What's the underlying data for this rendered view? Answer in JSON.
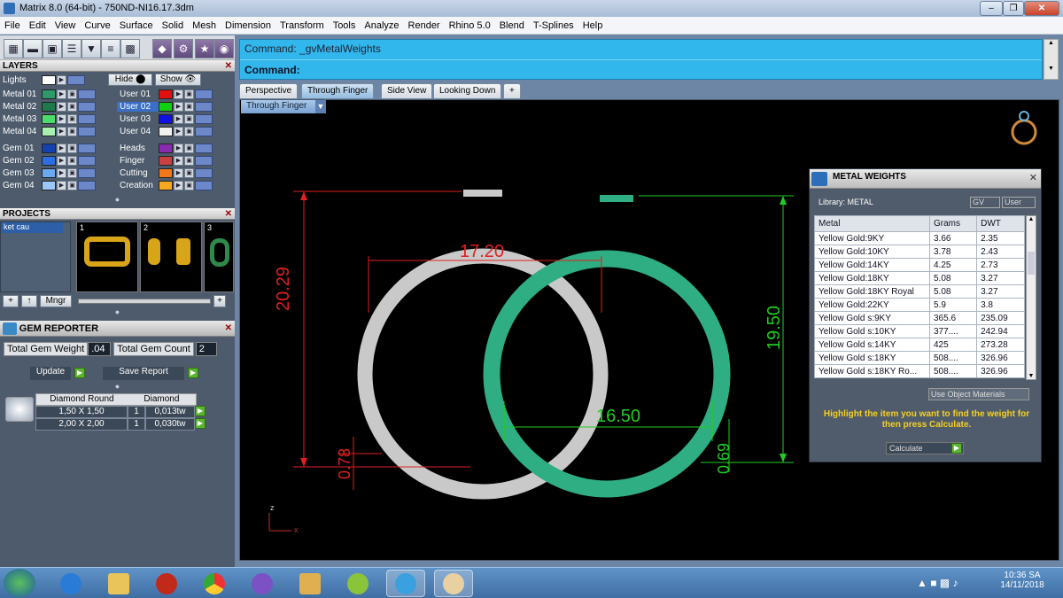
{
  "window": {
    "title": "Matrix 8.0 (64-bit) - 750ND-NI16.17.3dm"
  },
  "menu": [
    "File",
    "Edit",
    "View",
    "Curve",
    "Surface",
    "Solid",
    "Mesh",
    "Dimension",
    "Transform",
    "Tools",
    "Analyze",
    "Render",
    "Rhino 5.0",
    "Blend",
    "T-Splines",
    "Help"
  ],
  "layers": {
    "title": "LAYERS",
    "lights": "Lights",
    "hide": "Hide",
    "show": "Show",
    "left_rows": [
      {
        "name": "Metal 01",
        "color": "#2e9a6a"
      },
      {
        "name": "Metal 02",
        "color": "#1e7a4a"
      },
      {
        "name": "Metal 03",
        "color": "#4cdc6c"
      },
      {
        "name": "Metal 04",
        "color": "#a8f0b0"
      },
      {
        "name": "Gem 01",
        "color": "#1440b0"
      },
      {
        "name": "Gem 02",
        "color": "#2d6ee0"
      },
      {
        "name": "Gem 03",
        "color": "#6aa8f0"
      },
      {
        "name": "Gem 04",
        "color": "#9cc8f8"
      }
    ],
    "right_rows": [
      {
        "name": "User 01",
        "color": "#e01010"
      },
      {
        "name": "User 02",
        "color": "#10d010"
      },
      {
        "name": "User 03",
        "color": "#1010e0"
      },
      {
        "name": "User 04",
        "color": "#f0f0f0"
      },
      {
        "name": "Heads",
        "color": "#8a2ab0"
      },
      {
        "name": "Finger",
        "color": "#c84040"
      },
      {
        "name": "Cutting",
        "color": "#f07818"
      },
      {
        "name": "Creation",
        "color": "#f8a820"
      }
    ]
  },
  "projects": {
    "title": "PROJECTS",
    "item": "ket cau",
    "thumbs": [
      "1",
      "2",
      "3"
    ],
    "mngr": "Mngr"
  },
  "gem_reporter": {
    "title": "GEM REPORTER",
    "total_weight_label": "Total Gem Weight",
    "total_weight": ".04",
    "total_count_label": "Total Gem Count",
    "total_count": "2",
    "update": "Update",
    "save_report": "Save Report",
    "col1": "Diamond Round",
    "col2": "Diamond",
    "rows": [
      {
        "size": "1,50 X 1,50",
        "qty": "1",
        "weight": "0,013tw"
      },
      {
        "size": "2,00 X 2,00",
        "qty": "1",
        "weight": "0,030tw"
      }
    ]
  },
  "command": {
    "line1": "Command: _gvMetalWeights",
    "line2": "Command:"
  },
  "view_tabs": [
    "Perspective",
    "Through Finger",
    "Side View",
    "Looking Down",
    "+"
  ],
  "viewport_label": "Through Finger",
  "dimensions": {
    "d1": "17.20",
    "d2": "20.29",
    "d3": "0.78",
    "d4": "16.50",
    "d5": "19.50",
    "d6": "0.69"
  },
  "axes": {
    "z": "z",
    "x": "x"
  },
  "metal_weights": {
    "title": "METAL WEIGHTS",
    "library": "Library: METAL",
    "gv": "GV",
    "user": "User",
    "headers": [
      "Metal",
      "Grams",
      "DWT"
    ],
    "rows": [
      [
        "Yellow Gold:9KY",
        "3.66",
        "2.35"
      ],
      [
        "Yellow Gold:10KY",
        "3.78",
        "2.43"
      ],
      [
        "Yellow Gold:14KY",
        "4.25",
        "2.73"
      ],
      [
        "Yellow Gold:18KY",
        "5.08",
        "3.27"
      ],
      [
        "Yellow Gold:18KY Royal",
        "5.08",
        "3.27"
      ],
      [
        "Yellow Gold:22KY",
        "5.9",
        "3.8"
      ],
      [
        "Yellow Gold s:9KY",
        "365.6",
        "235.09"
      ],
      [
        "Yellow Gold s:10KY",
        "377....",
        "242.94"
      ],
      [
        "Yellow Gold s:14KY",
        "425",
        "273.28"
      ],
      [
        "Yellow Gold s:18KY",
        "508....",
        "326.96"
      ],
      [
        "Yellow Gold s:18KY Ro...",
        "508....",
        "326.96"
      ]
    ],
    "use_object_materials": "Use Object Materials",
    "instruction": "Highlight the item you want to find the weight for then press Calculate.",
    "calculate": "Calculate"
  },
  "taskbar": {
    "time": "10:36 SA",
    "date": "14/11/2018"
  }
}
